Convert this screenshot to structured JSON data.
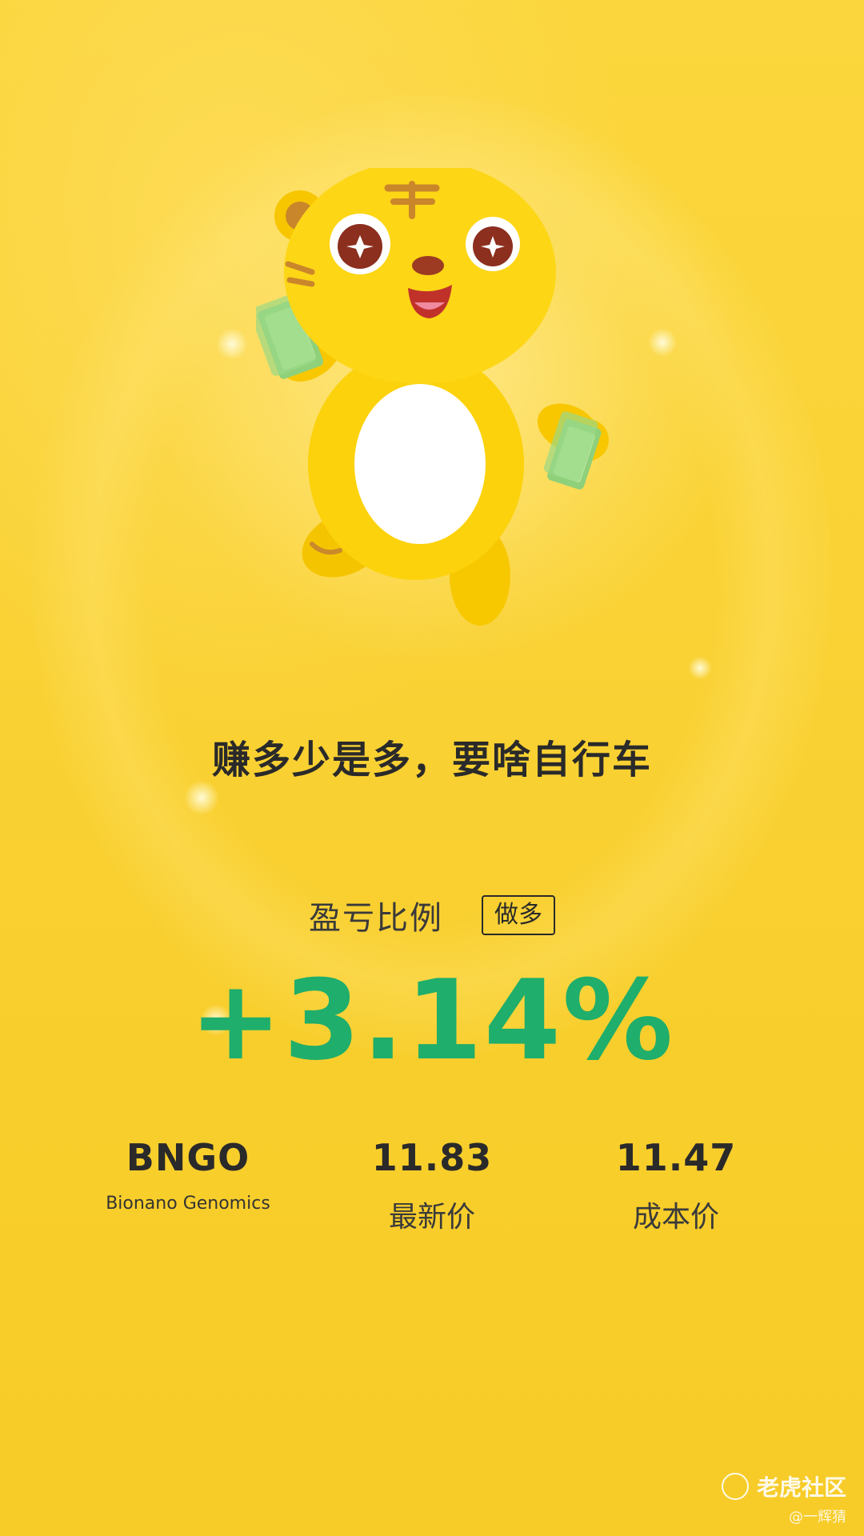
{
  "tagline": "赚多少是多，要啥自行车",
  "pnl": {
    "label": "盈亏比例",
    "direction": "做多",
    "value": "+3.14%"
  },
  "stock": {
    "symbol": "BNGO",
    "name": "Bionano Genomics"
  },
  "latest_price": {
    "value": "11.83",
    "label": "最新价"
  },
  "cost_price": {
    "value": "11.47",
    "label": "成本价"
  },
  "brand": {
    "name": "老虎社区",
    "icon": "tiger-community-logo-icon"
  },
  "watermark": "@一辉猜",
  "colors": {
    "background": "#f9cf2c",
    "gain": "#1fae6b",
    "text": "#2a2a2a"
  },
  "mascot_icon": "tiger-mascot-holding-cash"
}
